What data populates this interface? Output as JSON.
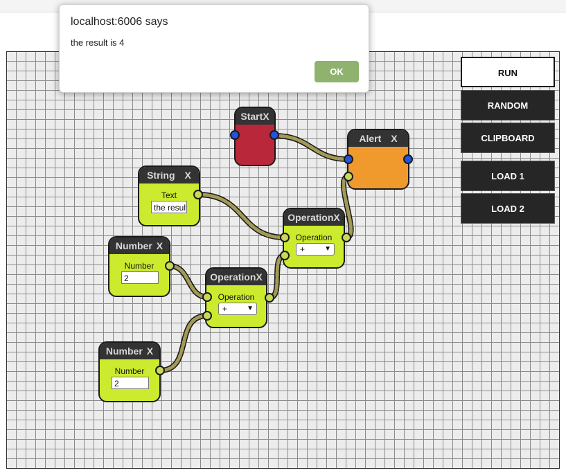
{
  "dialog": {
    "title": "localhost:6006 says",
    "message": "the result is 4",
    "ok_label": "OK"
  },
  "toolbar": {
    "run": "RUN",
    "random": "RANDOM",
    "clipboard": "CLIPBOARD",
    "load1": "LOAD 1",
    "load2": "LOAD 2"
  },
  "nodes": {
    "start": {
      "title": "Start",
      "close": "X",
      "color": "#b8283a"
    },
    "alert": {
      "title": "Alert",
      "close": "X",
      "color": "#f09a2e"
    },
    "string": {
      "title": "String",
      "close": "X",
      "label": "Text",
      "value": "the result is "
    },
    "number1": {
      "title": "Number",
      "close": "X",
      "label": "Number",
      "value": "2"
    },
    "number2": {
      "title": "Number",
      "close": "X",
      "label": "Number",
      "value": "2"
    },
    "operation1": {
      "title": "Operation",
      "close": "X",
      "label": "Operation",
      "selected": "+"
    },
    "operation2": {
      "title": "Operation",
      "close": "X",
      "label": "Operation",
      "selected": "+"
    }
  },
  "colors": {
    "node_yellow": "#ccea2e",
    "port_blue": "#2255dd",
    "wire": "#a39a57"
  }
}
